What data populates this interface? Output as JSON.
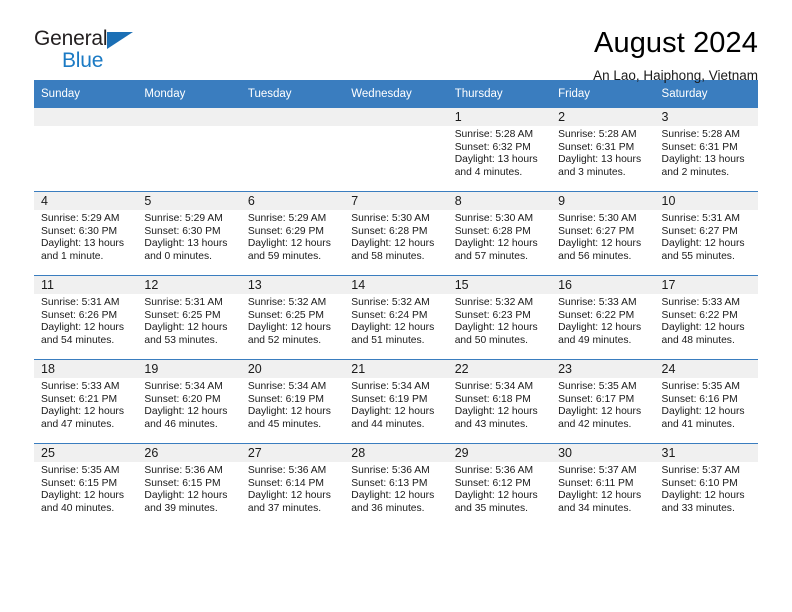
{
  "brand": {
    "name_line1": "General",
    "name_line2": "Blue",
    "accent_color": "#1b7ac4",
    "header_color": "#3a7dbf"
  },
  "header": {
    "title": "August 2024",
    "subtitle": "An Lao, Haiphong, Vietnam"
  },
  "calendar": {
    "weekday_headers": [
      "Sunday",
      "Monday",
      "Tuesday",
      "Wednesday",
      "Thursday",
      "Friday",
      "Saturday"
    ],
    "weeks": [
      [
        {
          "day": "",
          "sunrise": "",
          "sunset": "",
          "daylight": ""
        },
        {
          "day": "",
          "sunrise": "",
          "sunset": "",
          "daylight": ""
        },
        {
          "day": "",
          "sunrise": "",
          "sunset": "",
          "daylight": ""
        },
        {
          "day": "",
          "sunrise": "",
          "sunset": "",
          "daylight": ""
        },
        {
          "day": "1",
          "sunrise": "Sunrise: 5:28 AM",
          "sunset": "Sunset: 6:32 PM",
          "daylight": "Daylight: 13 hours and 4 minutes."
        },
        {
          "day": "2",
          "sunrise": "Sunrise: 5:28 AM",
          "sunset": "Sunset: 6:31 PM",
          "daylight": "Daylight: 13 hours and 3 minutes."
        },
        {
          "day": "3",
          "sunrise": "Sunrise: 5:28 AM",
          "sunset": "Sunset: 6:31 PM",
          "daylight": "Daylight: 13 hours and 2 minutes."
        }
      ],
      [
        {
          "day": "4",
          "sunrise": "Sunrise: 5:29 AM",
          "sunset": "Sunset: 6:30 PM",
          "daylight": "Daylight: 13 hours and 1 minute."
        },
        {
          "day": "5",
          "sunrise": "Sunrise: 5:29 AM",
          "sunset": "Sunset: 6:30 PM",
          "daylight": "Daylight: 13 hours and 0 minutes."
        },
        {
          "day": "6",
          "sunrise": "Sunrise: 5:29 AM",
          "sunset": "Sunset: 6:29 PM",
          "daylight": "Daylight: 12 hours and 59 minutes."
        },
        {
          "day": "7",
          "sunrise": "Sunrise: 5:30 AM",
          "sunset": "Sunset: 6:28 PM",
          "daylight": "Daylight: 12 hours and 58 minutes."
        },
        {
          "day": "8",
          "sunrise": "Sunrise: 5:30 AM",
          "sunset": "Sunset: 6:28 PM",
          "daylight": "Daylight: 12 hours and 57 minutes."
        },
        {
          "day": "9",
          "sunrise": "Sunrise: 5:30 AM",
          "sunset": "Sunset: 6:27 PM",
          "daylight": "Daylight: 12 hours and 56 minutes."
        },
        {
          "day": "10",
          "sunrise": "Sunrise: 5:31 AM",
          "sunset": "Sunset: 6:27 PM",
          "daylight": "Daylight: 12 hours and 55 minutes."
        }
      ],
      [
        {
          "day": "11",
          "sunrise": "Sunrise: 5:31 AM",
          "sunset": "Sunset: 6:26 PM",
          "daylight": "Daylight: 12 hours and 54 minutes."
        },
        {
          "day": "12",
          "sunrise": "Sunrise: 5:31 AM",
          "sunset": "Sunset: 6:25 PM",
          "daylight": "Daylight: 12 hours and 53 minutes."
        },
        {
          "day": "13",
          "sunrise": "Sunrise: 5:32 AM",
          "sunset": "Sunset: 6:25 PM",
          "daylight": "Daylight: 12 hours and 52 minutes."
        },
        {
          "day": "14",
          "sunrise": "Sunrise: 5:32 AM",
          "sunset": "Sunset: 6:24 PM",
          "daylight": "Daylight: 12 hours and 51 minutes."
        },
        {
          "day": "15",
          "sunrise": "Sunrise: 5:32 AM",
          "sunset": "Sunset: 6:23 PM",
          "daylight": "Daylight: 12 hours and 50 minutes."
        },
        {
          "day": "16",
          "sunrise": "Sunrise: 5:33 AM",
          "sunset": "Sunset: 6:22 PM",
          "daylight": "Daylight: 12 hours and 49 minutes."
        },
        {
          "day": "17",
          "sunrise": "Sunrise: 5:33 AM",
          "sunset": "Sunset: 6:22 PM",
          "daylight": "Daylight: 12 hours and 48 minutes."
        }
      ],
      [
        {
          "day": "18",
          "sunrise": "Sunrise: 5:33 AM",
          "sunset": "Sunset: 6:21 PM",
          "daylight": "Daylight: 12 hours and 47 minutes."
        },
        {
          "day": "19",
          "sunrise": "Sunrise: 5:34 AM",
          "sunset": "Sunset: 6:20 PM",
          "daylight": "Daylight: 12 hours and 46 minutes."
        },
        {
          "day": "20",
          "sunrise": "Sunrise: 5:34 AM",
          "sunset": "Sunset: 6:19 PM",
          "daylight": "Daylight: 12 hours and 45 minutes."
        },
        {
          "day": "21",
          "sunrise": "Sunrise: 5:34 AM",
          "sunset": "Sunset: 6:19 PM",
          "daylight": "Daylight: 12 hours and 44 minutes."
        },
        {
          "day": "22",
          "sunrise": "Sunrise: 5:34 AM",
          "sunset": "Sunset: 6:18 PM",
          "daylight": "Daylight: 12 hours and 43 minutes."
        },
        {
          "day": "23",
          "sunrise": "Sunrise: 5:35 AM",
          "sunset": "Sunset: 6:17 PM",
          "daylight": "Daylight: 12 hours and 42 minutes."
        },
        {
          "day": "24",
          "sunrise": "Sunrise: 5:35 AM",
          "sunset": "Sunset: 6:16 PM",
          "daylight": "Daylight: 12 hours and 41 minutes."
        }
      ],
      [
        {
          "day": "25",
          "sunrise": "Sunrise: 5:35 AM",
          "sunset": "Sunset: 6:15 PM",
          "daylight": "Daylight: 12 hours and 40 minutes."
        },
        {
          "day": "26",
          "sunrise": "Sunrise: 5:36 AM",
          "sunset": "Sunset: 6:15 PM",
          "daylight": "Daylight: 12 hours and 39 minutes."
        },
        {
          "day": "27",
          "sunrise": "Sunrise: 5:36 AM",
          "sunset": "Sunset: 6:14 PM",
          "daylight": "Daylight: 12 hours and 37 minutes."
        },
        {
          "day": "28",
          "sunrise": "Sunrise: 5:36 AM",
          "sunset": "Sunset: 6:13 PM",
          "daylight": "Daylight: 12 hours and 36 minutes."
        },
        {
          "day": "29",
          "sunrise": "Sunrise: 5:36 AM",
          "sunset": "Sunset: 6:12 PM",
          "daylight": "Daylight: 12 hours and 35 minutes."
        },
        {
          "day": "30",
          "sunrise": "Sunrise: 5:37 AM",
          "sunset": "Sunset: 6:11 PM",
          "daylight": "Daylight: 12 hours and 34 minutes."
        },
        {
          "day": "31",
          "sunrise": "Sunrise: 5:37 AM",
          "sunset": "Sunset: 6:10 PM",
          "daylight": "Daylight: 12 hours and 33 minutes."
        }
      ]
    ]
  }
}
